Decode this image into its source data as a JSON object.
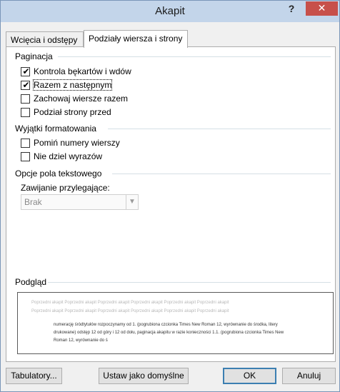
{
  "window": {
    "title": "Akapit",
    "help_symbol": "?",
    "close_symbol": "✕"
  },
  "tabs": [
    {
      "label": "Wcięcia i odstępy",
      "active": false
    },
    {
      "label": "Podziały wiersza i strony",
      "active": true
    }
  ],
  "pagination": {
    "heading": "Paginacja",
    "options": [
      {
        "label": "Kontrola bękartów i wdów",
        "checked": true
      },
      {
        "label": "Razem z następnym",
        "checked": true
      },
      {
        "label": "Zachowaj wiersze razem",
        "checked": false
      },
      {
        "label": "Podział strony przed",
        "checked": false
      }
    ]
  },
  "formatting_exceptions": {
    "heading": "Wyjątki formatowania",
    "options": [
      {
        "label": "Pomiń numery wierszy",
        "checked": false
      },
      {
        "label": "Nie dziel wyrazów",
        "checked": false
      }
    ]
  },
  "textbox_options": {
    "heading": "Opcje pola tekstowego",
    "wrap_label": "Zawijanie przylegające:",
    "wrap_value": "Brak"
  },
  "preview": {
    "heading": "Podgląd",
    "previous_text": "Poprzedni akapit Poprzedni akapit Poprzedni akapit Poprzedni akapit Poprzedni akapit Poprzedni akapit Poprzedni akapit Poprzedni akapit Poprzedni akapit Poprzedni akapit Poprzedni akapit Poprzedni akapit",
    "current_text": "numerację śródtytułów rozpoczynamy od 1. (pogrubiona czcionka Times New Roman 12, wyrównanie do środka, litery drukowane) odstęp 12 od góry i 12 od dołu, paginacja akapitu w razie konieczności 1.1. (pogrubiona czcionka Times New Roman 12, wyrównanie do ś"
  },
  "buttons": {
    "tabs": "Tabulatory...",
    "set_default": "Ustaw jako domyślne",
    "ok": "OK",
    "cancel": "Anuluj"
  }
}
